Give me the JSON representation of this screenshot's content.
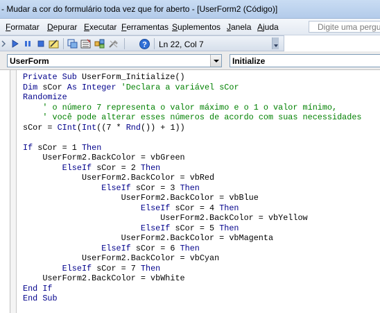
{
  "window": {
    "title": "- Mudar a cor do formulário toda vez que for aberto - [UserForm2 (Código)]"
  },
  "menu": {
    "items": [
      "Formatar",
      "Depurar",
      "Executar",
      "Ferramentas",
      "Suplementos",
      "Janela",
      "Ajuda"
    ],
    "help_placeholder": "Digite uma pergunta"
  },
  "toolbar": {
    "icons": [
      "run-icon",
      "pause-icon",
      "stop-icon",
      "design-mode-icon",
      "project-explorer-icon",
      "properties-icon",
      "object-browser-icon",
      "toolbox-icon",
      "help-icon"
    ],
    "status": "Ln 22, Col 7"
  },
  "dropdowns": {
    "object": "UserForm",
    "procedure": "Initialize"
  },
  "colors": {
    "keyword": "#00008b",
    "comment": "#008000"
  },
  "code": {
    "lines": [
      [
        {
          "t": "Private Sub",
          "c": "kw"
        },
        {
          "t": " UserForm_Initialize()"
        }
      ],
      [
        {
          "t": "Dim",
          "c": "kw"
        },
        {
          "t": " sCor "
        },
        {
          "t": "As Integer",
          "c": "kw"
        },
        {
          "t": " "
        },
        {
          "t": "'Declara a variável sCor",
          "c": "cm"
        }
      ],
      [
        {
          "t": "Randomize",
          "c": "kw"
        }
      ],
      [
        {
          "t": "    "
        },
        {
          "t": "' o número 7 representa o valor máximo e o 1 o valor mínimo,",
          "c": "cm"
        }
      ],
      [
        {
          "t": "    "
        },
        {
          "t": "' você pode alterar esses números de acordo com suas necessidades",
          "c": "cm"
        }
      ],
      [
        {
          "t": "sCor = "
        },
        {
          "t": "CInt",
          "c": "kw"
        },
        {
          "t": "("
        },
        {
          "t": "Int",
          "c": "kw"
        },
        {
          "t": "((7 * "
        },
        {
          "t": "Rnd",
          "c": "kw"
        },
        {
          "t": "()) + 1))"
        }
      ],
      [],
      [
        {
          "t": "If",
          "c": "kw"
        },
        {
          "t": " sCor = 1 "
        },
        {
          "t": "Then",
          "c": "kw"
        }
      ],
      [
        {
          "t": "    UserForm2.BackColor = vbGreen"
        }
      ],
      [
        {
          "t": "        "
        },
        {
          "t": "ElseIf",
          "c": "kw"
        },
        {
          "t": " sCor = 2 "
        },
        {
          "t": "Then",
          "c": "kw"
        }
      ],
      [
        {
          "t": "            UserForm2.BackColor = vbRed"
        }
      ],
      [
        {
          "t": "                "
        },
        {
          "t": "ElseIf",
          "c": "kw"
        },
        {
          "t": " sCor = 3 "
        },
        {
          "t": "Then",
          "c": "kw"
        }
      ],
      [
        {
          "t": "                    UserForm2.BackColor = vbBlue"
        }
      ],
      [
        {
          "t": "                        "
        },
        {
          "t": "ElseIf",
          "c": "kw"
        },
        {
          "t": " sCor = 4 "
        },
        {
          "t": "Then",
          "c": "kw"
        }
      ],
      [
        {
          "t": "                            UserForm2.BackColor = vbYellow"
        }
      ],
      [
        {
          "t": "                        "
        },
        {
          "t": "ElseIf",
          "c": "kw"
        },
        {
          "t": " sCor = 5 "
        },
        {
          "t": "Then",
          "c": "kw"
        }
      ],
      [
        {
          "t": "                    UserForm2.BackColor = vbMagenta"
        }
      ],
      [
        {
          "t": "                "
        },
        {
          "t": "ElseIf",
          "c": "kw"
        },
        {
          "t": " sCor = 6 "
        },
        {
          "t": "Then",
          "c": "kw"
        }
      ],
      [
        {
          "t": "            UserForm2.BackColor = vbCyan"
        }
      ],
      [
        {
          "t": "        "
        },
        {
          "t": "ElseIf",
          "c": "kw"
        },
        {
          "t": " sCor = 7 "
        },
        {
          "t": "Then",
          "c": "kw"
        }
      ],
      [
        {
          "t": "    UserForm2.BackColor = vbWhite"
        }
      ],
      [
        {
          "t": "End If",
          "c": "kw"
        }
      ],
      [
        {
          "t": "End Sub",
          "c": "kw"
        }
      ]
    ]
  }
}
